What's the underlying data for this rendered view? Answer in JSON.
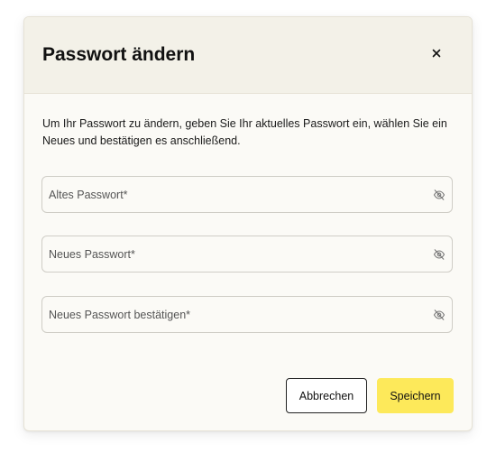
{
  "dialog": {
    "title": "Passwort ändern",
    "close_icon": "close-icon",
    "description": "Um Ihr Passwort zu ändern, geben Sie Ihr aktuelles Passwort ein, wählen Sie ein Neues und bestätigen es anschließend.",
    "fields": [
      {
        "placeholder": "Altes Passwort*",
        "value": "",
        "toggle_icon": "eye-off-icon"
      },
      {
        "placeholder": "Neues Passwort*",
        "value": "",
        "toggle_icon": "eye-off-icon"
      },
      {
        "placeholder": "Neues Passwort bestätigen*",
        "value": "",
        "toggle_icon": "eye-off-icon"
      }
    ],
    "buttons": {
      "cancel_label": "Abbrechen",
      "save_label": "Speichern"
    }
  },
  "colors": {
    "header_bg": "#f3f1e8",
    "body_bg": "#fbfaf6",
    "primary": "#fde95a",
    "border": "#cfcdc6"
  }
}
